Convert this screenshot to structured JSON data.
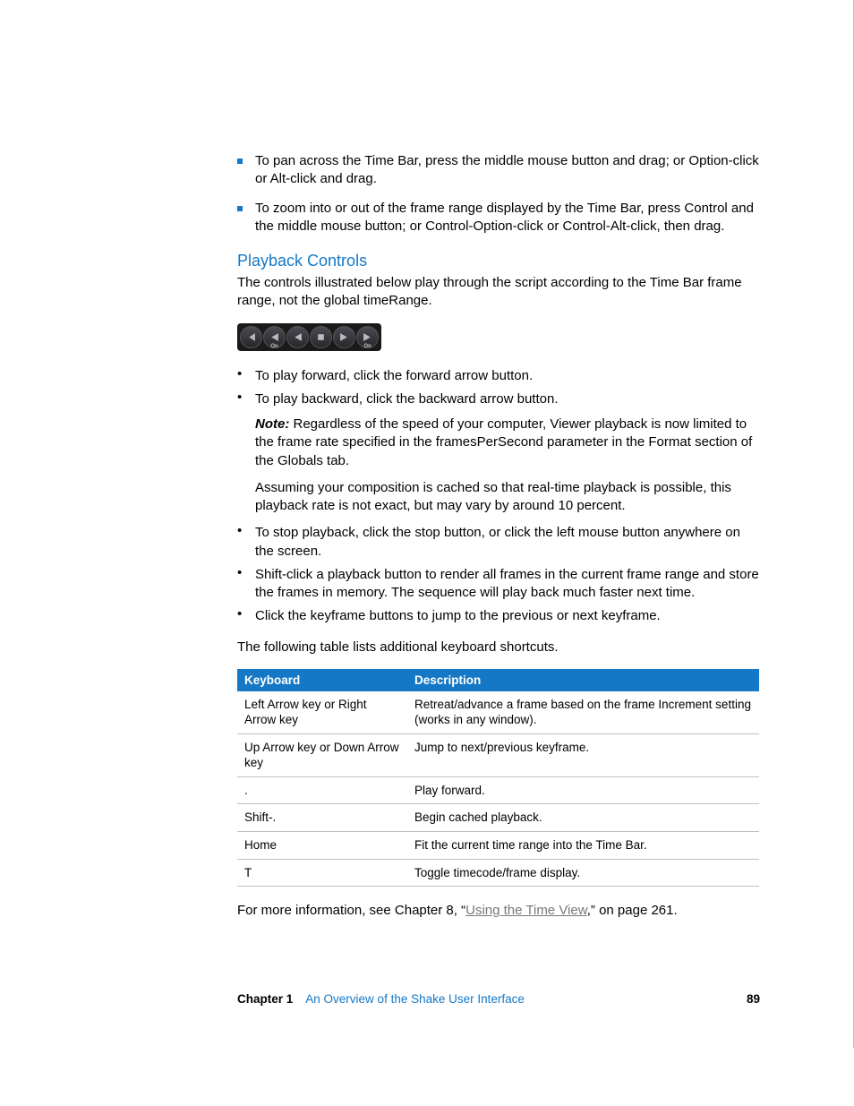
{
  "bullets_top": [
    "To pan across the Time Bar, press the middle mouse button and drag; or Option-click or Alt-click and drag.",
    "To zoom into or out of the frame range displayed by the Time Bar, press Control and the middle mouse button; or Control-Option-click or Control-Alt-click, then drag."
  ],
  "heading": "Playback Controls",
  "intro": "The controls illustrated below play through the script according to the Time Bar frame range, not the global timeRange.",
  "list2a": [
    "To play forward, click the forward arrow button.",
    "To play backward, click the backward arrow button."
  ],
  "note_label": "Note:",
  "note_body": "Regardless of the speed of your computer, Viewer playback is now limited to the frame rate specified in the framesPerSecond parameter in the Format section of the Globals tab.",
  "assuming": "Assuming your composition is cached so that real-time playback is possible, this playback rate is not exact, but may vary by around 10 percent.",
  "list2b": [
    "To stop playback, click the stop button, or click the left mouse button anywhere on the screen.",
    "Shift-click a playback button to render all frames in the current frame range and store the frames in memory. The sequence will play back much faster next time.",
    "Click the keyframe buttons to jump to the previous or next keyframe."
  ],
  "table_intro": "The following table lists additional keyboard shortcuts.",
  "table": {
    "headers": {
      "col1": "Keyboard",
      "col2": "Description"
    },
    "rows": [
      {
        "k": "Left Arrow key or Right Arrow key",
        "d": "Retreat/advance a frame based on the frame Increment setting (works in any window)."
      },
      {
        "k": "Up Arrow key or Down Arrow key",
        "d": "Jump to next/previous keyframe."
      },
      {
        "k": ".",
        "d": "Play forward."
      },
      {
        "k": "Shift-.",
        "d": "Begin cached playback."
      },
      {
        "k": "Home",
        "d": "Fit the current time range into the Time Bar."
      },
      {
        "k": "T",
        "d": "Toggle timecode/frame display."
      }
    ]
  },
  "post_pre": "For more information, see Chapter 8, “",
  "post_link": "Using the Time View",
  "post_post": ",” on page 261.",
  "footer": {
    "chapter": "Chapter 1",
    "title": "An Overview of the Shake User Interface",
    "page": "89"
  },
  "playback_icons": {
    "prev_keyframe": "prev-keyframe-icon",
    "play_back_on": "play-backward-cached-icon",
    "play_back": "play-backward-icon",
    "stop": "stop-icon",
    "play_fwd": "play-forward-icon",
    "next_keyframe": "play-forward-cached-icon",
    "on_label": "On"
  }
}
